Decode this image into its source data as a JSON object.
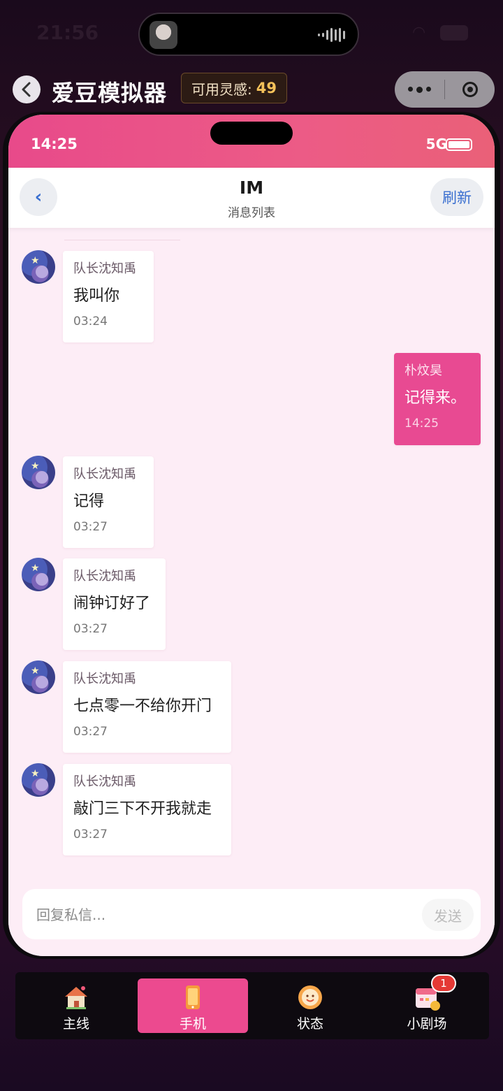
{
  "device_status": {
    "time": "21:56"
  },
  "mini_program": {
    "title": "爱豆模拟器",
    "inspiration_label": "可用灵感:",
    "inspiration_value": "49"
  },
  "phone": {
    "status": {
      "time": "14:25",
      "network": "5G"
    },
    "im": {
      "title": "IM",
      "subtitle": "消息列表",
      "back_symbol": "‹",
      "refresh_label": "刷新"
    },
    "messages": [
      {
        "sender": "队长沈知禹",
        "text": "我叫你",
        "time": "03:24",
        "self": false
      },
      {
        "sender": "朴炆昊",
        "text": "记得来。",
        "time": "14:25",
        "self": true
      },
      {
        "sender": "队长沈知禹",
        "text": "记得",
        "time": "03:27",
        "self": false
      },
      {
        "sender": "队长沈知禹",
        "text": "闹钟订好了",
        "time": "03:27",
        "self": false
      },
      {
        "sender": "队长沈知禹",
        "text": "七点零一不给你开门",
        "time": "03:27",
        "self": false
      },
      {
        "sender": "队长沈知禹",
        "text": "敲门三下不开我就走",
        "time": "03:27",
        "self": false
      }
    ],
    "composer": {
      "placeholder": "回复私信...",
      "send_label": "发送"
    }
  },
  "nav": {
    "items": [
      {
        "label": "主线",
        "icon": "house-icon",
        "active": false
      },
      {
        "label": "手机",
        "icon": "phone-icon",
        "active": true
      },
      {
        "label": "状态",
        "icon": "sun-face-icon",
        "active": false
      },
      {
        "label": "小剧场",
        "icon": "calendar-icon",
        "active": false,
        "badge": "1"
      }
    ]
  },
  "colors": {
    "accent": "#ec4a8f",
    "chat_bg": "#fdedf6",
    "self_bubble": "#e84a92"
  }
}
